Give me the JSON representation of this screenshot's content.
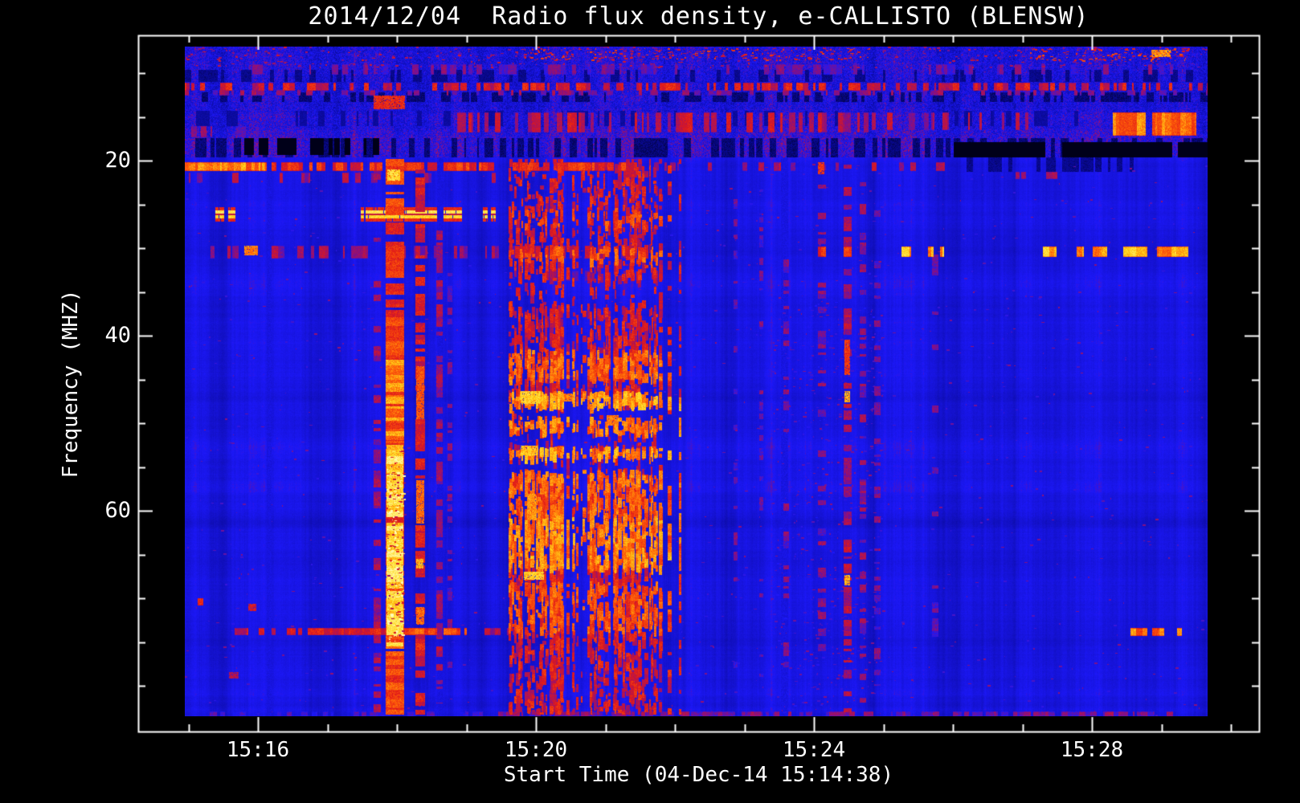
{
  "window": {
    "background": "#000000",
    "text_color": "#ffffff",
    "axis_color": "#ffffff"
  },
  "chart_data": {
    "type": "heatmap",
    "title": "2014/12/04  Radio flux density, e-CALLISTO (BLENSW)",
    "xlabel": "Start Time (04-Dec-14 15:14:38)",
    "ylabel": "Frequency (MHZ)",
    "x_tick_labels": [
      "15:16",
      "15:20",
      "15:24",
      "15:28"
    ],
    "x_tick_minutes": [
      16,
      20,
      24,
      28
    ],
    "x_minor_tick_minutes": [
      15,
      17,
      18,
      19,
      21,
      22,
      23,
      25,
      26,
      27,
      29,
      30
    ],
    "y_tick_labels": [
      "20",
      "40",
      "60"
    ],
    "y_tick_mhz": [
      20,
      40,
      60
    ],
    "y_minor_tick_mhz": [
      10,
      15,
      25,
      30,
      35,
      45,
      50,
      55,
      65,
      70,
      75,
      80
    ],
    "y_range_mhz": [
      7.0,
      83.5
    ],
    "x_range_time": [
      "15:14:57",
      "15:29:40"
    ],
    "grid": false,
    "legend": false,
    "colormap": "CALLISTO blue-red-yellow",
    "palette": {
      "background_blue": "#1c18f8",
      "dark_patch": "#000019",
      "red": "#d7191e",
      "orange": "#ff5f08",
      "yellow": "#ffd719",
      "pale_peak": "#fffcb9"
    },
    "description": "Solar radio spectrogram: type III burst at ~15:17:50-15:18:06, burst group ~15:19:37-15:21:43, ionospheric noise band 7-20 MHz, RFI lines at ~11.5, 20, 26, 30 and 73.5 MHz",
    "features": [
      {
        "type": "noise",
        "m0": 14.95,
        "m1": 29.66,
        "f0": 7.0,
        "f1": 19.6,
        "amp": 0.13
      },
      {
        "type": "dark",
        "m0": 14.95,
        "m1": 29.66,
        "f0": 9.6,
        "f1": 11.0,
        "drop": 0.3,
        "density": 0.35
      },
      {
        "type": "dark",
        "m0": 14.95,
        "m1": 29.66,
        "f0": 12.2,
        "f1": 13.3,
        "drop": 0.33,
        "density": 0.4
      },
      {
        "type": "dark",
        "m0": 14.95,
        "m1": 29.66,
        "f0": 14.3,
        "f1": 16.1,
        "drop": 0.25,
        "density": 0.22
      },
      {
        "type": "dark",
        "m0": 14.95,
        "m1": 29.66,
        "f0": 17.4,
        "f1": 19.6,
        "drop": 0.33,
        "density": 0.45
      },
      {
        "type": "dark",
        "m0": 15.8,
        "m1": 17.9,
        "f0": 17.4,
        "f1": 19.4,
        "drop": 0.5,
        "density": 0.55
      },
      {
        "type": "row",
        "m0": 14.95,
        "m1": 29.66,
        "f0": 11.1,
        "f1": 12.0,
        "level": 0.66,
        "density": 0.55
      },
      {
        "type": "row",
        "m0": 14.95,
        "m1": 29.66,
        "f0": 9.0,
        "f1": 10.2,
        "level": 0.52,
        "density": 0.28
      },
      {
        "type": "row",
        "m0": 14.95,
        "m1": 29.66,
        "f0": 11.9,
        "f1": 12.6,
        "level": 0.56,
        "density": 0.3
      },
      {
        "type": "speckle",
        "m0": 14.95,
        "m1": 29.66,
        "f0": 7.0,
        "f1": 9.4,
        "level": 0.6,
        "density": 0.1
      },
      {
        "type": "speckle",
        "m0": 19.7,
        "m1": 24.8,
        "f0": 7.2,
        "f1": 8.5,
        "level": 0.68,
        "density": 0.3
      },
      {
        "type": "speckle",
        "m0": 27.1,
        "m1": 29.4,
        "f0": 7.2,
        "f1": 8.6,
        "level": 0.7,
        "density": 0.3
      },
      {
        "type": "spot",
        "m0": 28.86,
        "m1": 29.13,
        "f0": 7.3,
        "f1": 8.2,
        "level": 0.82
      },
      {
        "type": "row",
        "m0": 18.8,
        "m1": 24.83,
        "f0": 14.5,
        "f1": 16.8,
        "level": 0.62,
        "density": 0.45
      },
      {
        "type": "row",
        "m0": 24.77,
        "m1": 27.3,
        "f0": 14.5,
        "f1": 16.5,
        "level": 0.6,
        "density": 0.4
      },
      {
        "type": "row",
        "m0": 28.3,
        "m1": 29.5,
        "f0": 14.5,
        "f1": 17.2,
        "level": 0.78,
        "density": 0.75
      },
      {
        "type": "row",
        "m0": 14.95,
        "m1": 17.2,
        "f0": 16.1,
        "f1": 17.3,
        "level": 0.55,
        "density": 0.25
      },
      {
        "type": "dark",
        "m0": 26.01,
        "m1": 29.66,
        "f0": 17.9,
        "f1": 19.6,
        "drop": 0.65,
        "density": 0.92
      },
      {
        "type": "dark",
        "m0": 26.05,
        "m1": 28.6,
        "f0": 19.6,
        "f1": 21.3,
        "drop": 0.3,
        "density": 0.5
      },
      {
        "type": "row",
        "m0": 14.95,
        "m1": 16.1,
        "f0": 20.2,
        "f1": 21.2,
        "level": 0.8,
        "density": 0.92
      },
      {
        "type": "row",
        "m0": 16.1,
        "m1": 21.48,
        "f0": 20.2,
        "f1": 21.2,
        "level": 0.7,
        "density": 0.7
      },
      {
        "type": "row",
        "m0": 21.48,
        "m1": 25.9,
        "f0": 20.2,
        "f1": 21.2,
        "level": 0.6,
        "density": 0.2
      },
      {
        "type": "row",
        "m0": 26.9,
        "m1": 27.5,
        "f0": 21.3,
        "f1": 22.1,
        "level": 0.62,
        "density": 0.35
      },
      {
        "type": "row",
        "m0": 15.0,
        "m1": 19.5,
        "f0": 21.4,
        "f1": 22.6,
        "level": 0.58,
        "density": 0.2
      },
      {
        "type": "band",
        "density": 0.96,
        "segs": [
          [
            15.39,
            15.51
          ],
          [
            15.57,
            15.68
          ],
          [
            17.48,
            17.53
          ],
          [
            17.55,
            18.94
          ],
          [
            19.24,
            19.31
          ],
          [
            19.35,
            19.42
          ]
        ],
        "layers": [
          [
            25.3,
            25.65,
            0.7
          ],
          [
            25.65,
            26.05,
            0.92
          ],
          [
            26.05,
            26.25,
            0.64
          ],
          [
            26.25,
            26.65,
            0.89
          ],
          [
            26.65,
            27.0,
            0.7
          ]
        ]
      },
      {
        "type": "row",
        "m0": 15.16,
        "m1": 21.48,
        "f0": 29.7,
        "f1": 31.2,
        "level": 0.58,
        "density": 0.38
      },
      {
        "type": "spot",
        "m0": 15.8,
        "m1": 16.0,
        "f0": 29.7,
        "f1": 30.8,
        "level": 0.8
      },
      {
        "type": "row",
        "m0": 19.61,
        "m1": 21.48,
        "f0": 29.7,
        "f1": 31.2,
        "level": 0.63,
        "density": 0.5
      },
      {
        "type": "row",
        "m0": 19.61,
        "m1": 21.48,
        "f0": 32.6,
        "f1": 33.8,
        "level": 0.53,
        "density": 0.3
      },
      {
        "type": "row",
        "m0": 24.06,
        "m1": 24.17,
        "f0": 29.8,
        "f1": 31.0,
        "level": 0.7,
        "density": 0.7
      },
      {
        "type": "row",
        "m0": 24.43,
        "m1": 24.54,
        "f0": 29.8,
        "f1": 31.0,
        "level": 0.72,
        "density": 0.7
      },
      {
        "type": "row",
        "m0": 25.26,
        "m1": 25.41,
        "f0": 29.8,
        "f1": 31.0,
        "level": 0.84,
        "density": 0.75
      },
      {
        "type": "row",
        "m0": 25.64,
        "m1": 25.87,
        "f0": 29.8,
        "f1": 31.0,
        "level": 0.84,
        "density": 0.75
      },
      {
        "type": "row",
        "m0": 27.3,
        "m1": 27.49,
        "f0": 29.8,
        "f1": 31.0,
        "level": 0.84,
        "density": 0.75
      },
      {
        "type": "row",
        "m0": 27.78,
        "m1": 27.92,
        "f0": 29.8,
        "f1": 31.0,
        "level": 0.84,
        "density": 0.7
      },
      {
        "type": "row",
        "m0": 28.01,
        "m1": 28.22,
        "f0": 29.8,
        "f1": 31.0,
        "level": 0.84,
        "density": 0.75
      },
      {
        "type": "row",
        "m0": 28.42,
        "m1": 28.8,
        "f0": 29.8,
        "f1": 31.0,
        "level": 0.86,
        "density": 0.78
      },
      {
        "type": "row",
        "m0": 28.94,
        "m1": 29.51,
        "f0": 29.8,
        "f1": 31.0,
        "level": 0.84,
        "density": 0.7
      },
      {
        "type": "row",
        "m0": 15.56,
        "m1": 16.5,
        "f0": 73.4,
        "f1": 74.2,
        "level": 0.64,
        "density": 0.5
      },
      {
        "type": "row",
        "m0": 16.5,
        "m1": 18.1,
        "f0": 73.4,
        "f1": 74.2,
        "level": 0.68,
        "density": 0.72
      },
      {
        "type": "row",
        "m0": 18.1,
        "m1": 19.0,
        "f0": 73.4,
        "f1": 74.2,
        "level": 0.74,
        "density": 0.8
      },
      {
        "type": "row",
        "m0": 19.0,
        "m1": 19.7,
        "f0": 73.4,
        "f1": 74.2,
        "level": 0.6,
        "density": 0.3
      },
      {
        "type": "row",
        "m0": 28.55,
        "m1": 29.3,
        "f0": 73.4,
        "f1": 74.3,
        "level": 0.78,
        "density": 0.75
      },
      {
        "type": "row",
        "m0": 19.46,
        "m1": 29.2,
        "f0": 82.9,
        "f1": 83.5,
        "level": 0.55,
        "density": 0.7
      },
      {
        "type": "row",
        "m0": 14.95,
        "m1": 19.46,
        "f0": 82.9,
        "f1": 83.5,
        "level": 0.48,
        "density": 0.3
      },
      {
        "type": "spot",
        "m0": 15.13,
        "m1": 15.21,
        "f0": 70.0,
        "f1": 70.8,
        "level": 0.7
      },
      {
        "type": "spot",
        "m0": 15.86,
        "m1": 15.98,
        "f0": 70.6,
        "f1": 71.5,
        "level": 0.66
      },
      {
        "type": "spot",
        "m0": 15.58,
        "m1": 15.72,
        "f0": 78.4,
        "f1": 79.2,
        "level": 0.62
      },
      {
        "type": "speckle",
        "m0": 14.95,
        "m1": 29.66,
        "f0": 19.6,
        "f1": 83.5,
        "level": 0.52,
        "density": 0.012
      },
      {
        "type": "dark",
        "m0": 14.95,
        "m1": 29.66,
        "f0": 19.6,
        "f1": 83.5,
        "drop": 0.05,
        "density": 0.04
      },
      {
        "type": "spot",
        "m0": 17.67,
        "m1": 18.12,
        "f0": 12.6,
        "f1": 14.1,
        "level": 0.7
      },
      {
        "type": "column",
        "m0": 17.67,
        "m1": 17.77,
        "f0": 20.4,
        "f1": 83.0,
        "level": 0.58,
        "density": 0.35
      },
      {
        "type": "column",
        "m0": 17.84,
        "m1": 18.1,
        "f0": 19.8,
        "f1": 83.3,
        "level": 0.72,
        "density": 0.85,
        "set": 1
      },
      {
        "type": "spot",
        "m0": 17.86,
        "m1": 18.05,
        "f0": 21.0,
        "f1": 22.3,
        "level": 0.9
      },
      {
        "type": "column",
        "m0": 17.84,
        "m1": 18.1,
        "f0": 42.0,
        "f1": 52.5,
        "level": 0.8,
        "density": 0.8
      },
      {
        "type": "column",
        "m0": 17.85,
        "m1": 18.09,
        "f0": 52.5,
        "f1": 75.5,
        "level": 0.9,
        "density": 0.9
      },
      {
        "type": "speckle",
        "m0": 17.85,
        "m1": 18.09,
        "f0": 53.0,
        "f1": 75.0,
        "level": 0.97,
        "density": 0.25
      },
      {
        "type": "speckle",
        "m0": 17.85,
        "m1": 18.09,
        "f0": 53.0,
        "f1": 75.0,
        "level": 0.66,
        "density": 0.2,
        "set": 1
      },
      {
        "type": "column",
        "m0": 17.84,
        "m1": 18.1,
        "f0": 75.5,
        "f1": 83.3,
        "level": 0.74,
        "density": 0.7,
        "set": 1
      },
      {
        "type": "column",
        "m0": 18.27,
        "m1": 18.4,
        "f0": 21.0,
        "f1": 83.3,
        "level": 0.66,
        "density": 0.6,
        "set": 1
      },
      {
        "type": "spot",
        "m0": 18.28,
        "m1": 18.39,
        "f0": 43.5,
        "f1": 49.5,
        "level": 0.76
      },
      {
        "type": "spot",
        "m0": 18.28,
        "m1": 18.39,
        "f0": 56.5,
        "f1": 61.5,
        "level": 0.78
      },
      {
        "type": "spot",
        "m0": 18.28,
        "m1": 18.38,
        "f0": 65.5,
        "f1": 66.6,
        "level": 0.85
      },
      {
        "type": "spot",
        "m0": 18.28,
        "m1": 18.39,
        "f0": 71.0,
        "f1": 73.0,
        "level": 0.78
      },
      {
        "type": "column",
        "m0": 18.57,
        "m1": 18.66,
        "f0": 28.0,
        "f1": 82.0,
        "level": 0.58,
        "density": 0.45
      },
      {
        "type": "column",
        "m0": 18.73,
        "m1": 18.8,
        "f0": 32.0,
        "f1": 80.0,
        "level": 0.54,
        "density": 0.3
      },
      {
        "type": "group",
        "m0": 19.61,
        "m1": 21.71,
        "fringe": 22.12,
        "f0": 19.8,
        "f1": 83.3,
        "level": 0.58,
        "count": 120,
        "rowboosts": [
          [
            41.5,
            44.8,
            0.1
          ],
          [
            46.3,
            47.8,
            0.16
          ],
          [
            49.1,
            50.9,
            0.12
          ],
          [
            52.6,
            53.7,
            0.15
          ],
          [
            55.3,
            60.5,
            0.1
          ],
          [
            60.5,
            66.5,
            0.13
          ],
          [
            68.0,
            73.5,
            0.08
          ],
          [
            25.3,
            27.2,
            0.06
          ],
          [
            29.7,
            31.2,
            0.08
          ]
        ],
        "gaps": [
          [
            47.9,
            49.0
          ],
          [
            51.0,
            52.4
          ],
          [
            53.8,
            55.2
          ],
          [
            33.5,
            36.0
          ]
        ],
        "vgap": [
          20.59,
          20.69
        ]
      },
      {
        "type": "spot",
        "m0": 19.78,
        "m1": 20.07,
        "f0": 46.3,
        "f1": 47.8,
        "level": 0.88
      },
      {
        "type": "spot",
        "m0": 19.78,
        "m1": 20.03,
        "f0": 52.6,
        "f1": 53.7,
        "level": 0.86
      },
      {
        "type": "spot",
        "m0": 19.83,
        "m1": 20.12,
        "f0": 67.0,
        "f1": 67.9,
        "level": 0.88
      },
      {
        "type": "spot",
        "m0": 19.87,
        "m1": 20.01,
        "f0": 58.1,
        "f1": 61.1,
        "level": 0.82
      },
      {
        "type": "spot",
        "m0": 20.38,
        "m1": 20.52,
        "f0": 46.6,
        "f1": 47.5,
        "level": 0.8
      },
      {
        "type": "spot",
        "m0": 21.02,
        "m1": 21.19,
        "f0": 49.1,
        "f1": 50.3,
        "level": 0.8
      },
      {
        "type": "spot",
        "m0": 20.27,
        "m1": 20.4,
        "f0": 52.7,
        "f1": 53.6,
        "level": 0.78
      },
      {
        "type": "column",
        "m0": 22.84,
        "m1": 22.9,
        "f0": 21.0,
        "f1": 79.0,
        "level": 0.52,
        "density": 0.25
      },
      {
        "type": "column",
        "m0": 23.21,
        "m1": 23.27,
        "f0": 21.0,
        "f1": 79.0,
        "level": 0.52,
        "density": 0.25
      },
      {
        "type": "column",
        "m0": 23.56,
        "m1": 23.64,
        "f0": 28.0,
        "f1": 80.0,
        "level": 0.54,
        "density": 0.32
      },
      {
        "type": "column",
        "m0": 24.06,
        "m1": 24.17,
        "f0": 20.5,
        "f1": 80.0,
        "level": 0.55,
        "density": 0.35
      },
      {
        "type": "spot",
        "m0": 24.06,
        "m1": 24.15,
        "f0": 20.2,
        "f1": 21.6,
        "level": 0.72
      },
      {
        "type": "column",
        "m0": 24.43,
        "m1": 24.54,
        "f0": 19.8,
        "f1": 83.0,
        "level": 0.6,
        "density": 0.55
      },
      {
        "type": "spot",
        "m0": 24.44,
        "m1": 24.52,
        "f0": 40.5,
        "f1": 44.5,
        "level": 0.72
      },
      {
        "type": "spot",
        "m0": 24.44,
        "m1": 24.52,
        "f0": 46.3,
        "f1": 47.6,
        "level": 0.84
      },
      {
        "type": "spot",
        "m0": 24.44,
        "m1": 24.52,
        "f0": 67.3,
        "f1": 68.5,
        "level": 0.84
      },
      {
        "type": "column",
        "m0": 24.66,
        "m1": 24.75,
        "f0": 21.0,
        "f1": 82.0,
        "level": 0.56,
        "density": 0.4
      },
      {
        "type": "column",
        "m0": 24.87,
        "m1": 24.96,
        "f0": 25.0,
        "f1": 80.0,
        "level": 0.53,
        "density": 0.28
      },
      {
        "type": "column",
        "m0": 25.7,
        "m1": 25.79,
        "f0": 30.0,
        "f1": 78.0,
        "level": 0.52,
        "density": 0.2
      },
      {
        "type": "speckle",
        "m0": 23.4,
        "m1": 25.0,
        "f0": 36.0,
        "f1": 83.0,
        "level": 0.5,
        "density": 0.06
      }
    ]
  }
}
